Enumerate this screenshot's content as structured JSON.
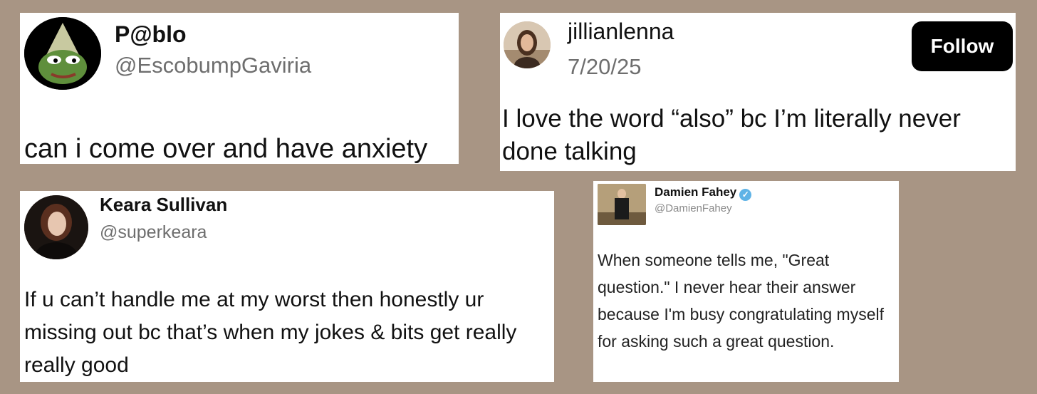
{
  "tweets": [
    {
      "name": "P@blo",
      "handle": "@EscobumpGaviria",
      "text": "can i come over and have anxiety"
    },
    {
      "name": "jillianlenna",
      "date": "7/20/25",
      "follow_label": "Follow",
      "text": "I love the word “also” bc I’m literally never done talking"
    },
    {
      "name": "Keara Sullivan",
      "handle": "@superkeara",
      "text": "If u can’t handle me at my worst then honestly ur missing out bc that’s when my jokes & bits get really really good"
    },
    {
      "name": "Damien Fahey",
      "handle": "@DamienFahey",
      "text": "When someone tells me, \"Great question.\" I never hear their answer because I'm busy congratulating myself for asking such a great question."
    }
  ],
  "icons": {
    "avatar1": "pepe-avatar-icon",
    "avatar2": "profile-photo",
    "avatar3": "profile-photo",
    "avatar4": "profile-photo",
    "verified": "verified-badge-icon"
  },
  "colors": {
    "background": "#a89584",
    "verified": "#5fb3e6",
    "follow_button": "#000000"
  }
}
